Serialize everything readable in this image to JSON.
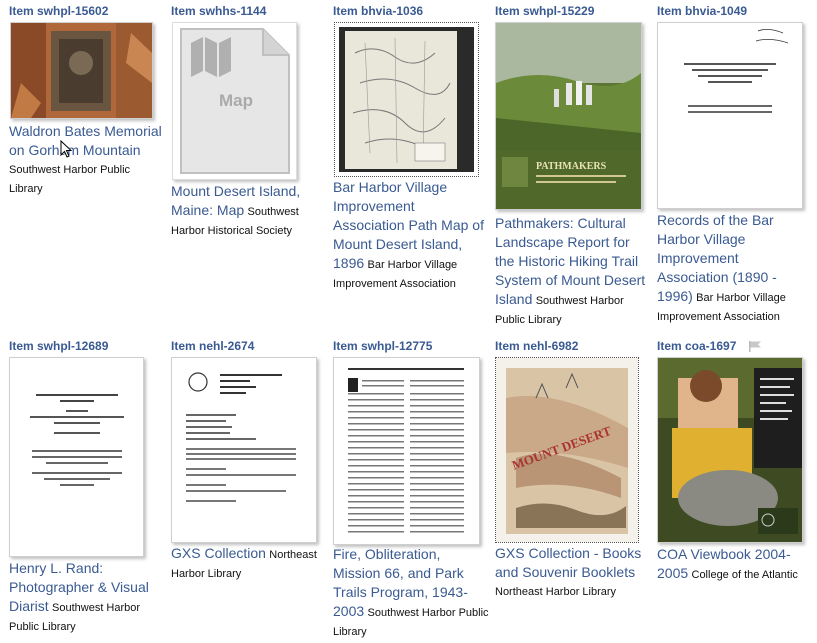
{
  "items": [
    {
      "id": "Item swhpl-15602",
      "title": "Waldron Bates Memorial on Gorham Mountain",
      "owner": "Southwest Harbor Public Library",
      "thumb": "photo"
    },
    {
      "id": "Item swhhs-1144",
      "title": "Mount Desert Island, Maine: Map",
      "owner": "Southwest Harbor Historical Society",
      "thumb": "map-placeholder",
      "placeholder_label": "Map"
    },
    {
      "id": "Item bhvia-1036",
      "title": "Bar Harbor Village Improvement Association Path Map of Mount Desert Island, 1896",
      "owner": "Bar Harbor Village Improvement Association",
      "thumb": "map"
    },
    {
      "id": "Item swhpl-15229",
      "title": "Pathmakers: Cultural Landscape Report for the Historic Hiking Trail System of Mount Desert Island",
      "owner": "Southwest Harbor Public Library",
      "thumb": "book-cover",
      "cover_text": "PATHMAKERS"
    },
    {
      "id": "Item bhvia-1049",
      "title": "Records of the Bar Harbor Village Improvement Association (1890 - 1996)",
      "owner": "Bar Harbor Village Improvement Association",
      "thumb": "document"
    },
    {
      "id": "Item swhpl-12689",
      "title": "Henry L. Rand: Photographer & Visual Diarist",
      "owner": "Southwest Harbor Public Library",
      "thumb": "document"
    },
    {
      "id": "Item nehl-2674",
      "title": "GXS Collection",
      "owner": "Northeast Harbor Library",
      "thumb": "finding-aid"
    },
    {
      "id": "Item swhpl-12775",
      "title": "Fire, Obliteration, Mission 66, and Park Trails Program, 1943-2003",
      "owner": "Southwest Harbor Public Library",
      "thumb": "text-page"
    },
    {
      "id": "Item nehl-6982",
      "title": "GXS Collection - Books and Souvenir Booklets",
      "owner": "Northeast Harbor Library",
      "thumb": "booklet",
      "cover_text": "MOUNT DESERT"
    },
    {
      "id": "Item coa-1697",
      "title": "COA Viewbook 2004-2005",
      "owner": "College of the Atlantic",
      "thumb": "viewbook"
    }
  ],
  "colors": {
    "link": "#3a5a92",
    "owner": "#111111"
  }
}
